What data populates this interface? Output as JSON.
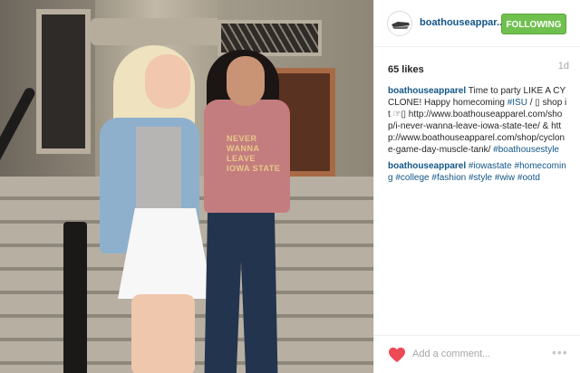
{
  "header": {
    "username": "boathouseappar...",
    "follow_label": "FOLLOWING"
  },
  "stats": {
    "likes": "65 likes",
    "age": "1d"
  },
  "photo": {
    "shirt_text": "NEVER WANNA LEAVE IOWA STATE"
  },
  "comments": [
    {
      "user": "boathouseapparel",
      "t1": " Time to party LIKE A CYCLONE! Happy homecoming ",
      "l1": "#ISU",
      "t2": " / ▯ shop it ☞▯ http://www.boathouseapparel.com/shop/i-never-wanna-leave-iowa-state-tee/ & http://www.boathouseapparel.com/shop/cyclone-game-day-muscle-tank/ ",
      "l2": "#boathousestyle"
    },
    {
      "user": "boathouseapparel",
      "tags": [
        "#iowastate",
        "#homecoming",
        "#college",
        "#fashion",
        "#style",
        "#wiw",
        "#ootd"
      ]
    }
  ],
  "footer": {
    "comment_placeholder": "Add a comment...",
    "more_label": "•••"
  },
  "colors": {
    "link": "#125688",
    "follow": "#70c050",
    "heart": "#ed4956"
  }
}
